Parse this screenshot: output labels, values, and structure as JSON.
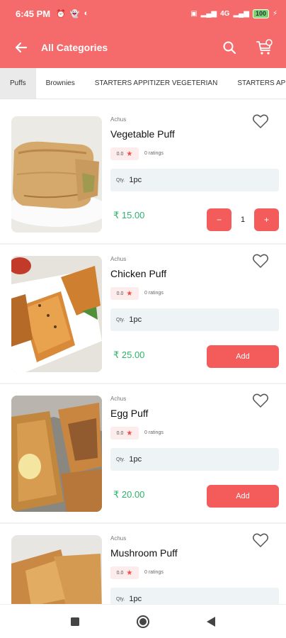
{
  "status_bar": {
    "time": "6:45 PM",
    "network": "4G",
    "battery": "100"
  },
  "app_bar": {
    "title": "All Categories"
  },
  "tabs": [
    {
      "label": "Puffs",
      "active": true
    },
    {
      "label": "Brownies",
      "active": false
    },
    {
      "label": "STARTERS APPITIZER VEGETERIAN",
      "active": false
    },
    {
      "label": "STARTERS APPITI",
      "active": false
    }
  ],
  "products": [
    {
      "brand": "Achus",
      "name": "Vegetable Puff",
      "rating": "0.0",
      "ratings_count": "0 ratings",
      "qty_label": "Qty.",
      "qty": "1pc",
      "price": "₹ 15.00",
      "in_cart": true,
      "cart_count": "1",
      "image": "vegetable-puff-photo"
    },
    {
      "brand": "Achus",
      "name": "Chicken Puff",
      "rating": "0.0",
      "ratings_count": "0 ratings",
      "qty_label": "Qty.",
      "qty": "1pc",
      "price": "₹ 25.00",
      "in_cart": false,
      "add_label": "Add",
      "image": "chicken-puff-photo"
    },
    {
      "brand": "Achus",
      "name": "Egg Puff",
      "rating": "0.0",
      "ratings_count": "0 ratings",
      "qty_label": "Qty.",
      "qty": "1pc",
      "price": "₹ 20.00",
      "in_cart": false,
      "add_label": "Add",
      "image": "egg-puff-photo"
    },
    {
      "brand": "Achus",
      "name": "Mushroom Puff",
      "rating": "0.0",
      "ratings_count": "0 ratings",
      "qty_label": "Qty.",
      "qty": "1pc",
      "image": "mushroom-puff-photo"
    }
  ],
  "stepper": {
    "minus": "−",
    "plus": "+"
  },
  "colors": {
    "primary": "#f56a6a",
    "button": "#f45b5b",
    "price": "#2fb26b"
  }
}
